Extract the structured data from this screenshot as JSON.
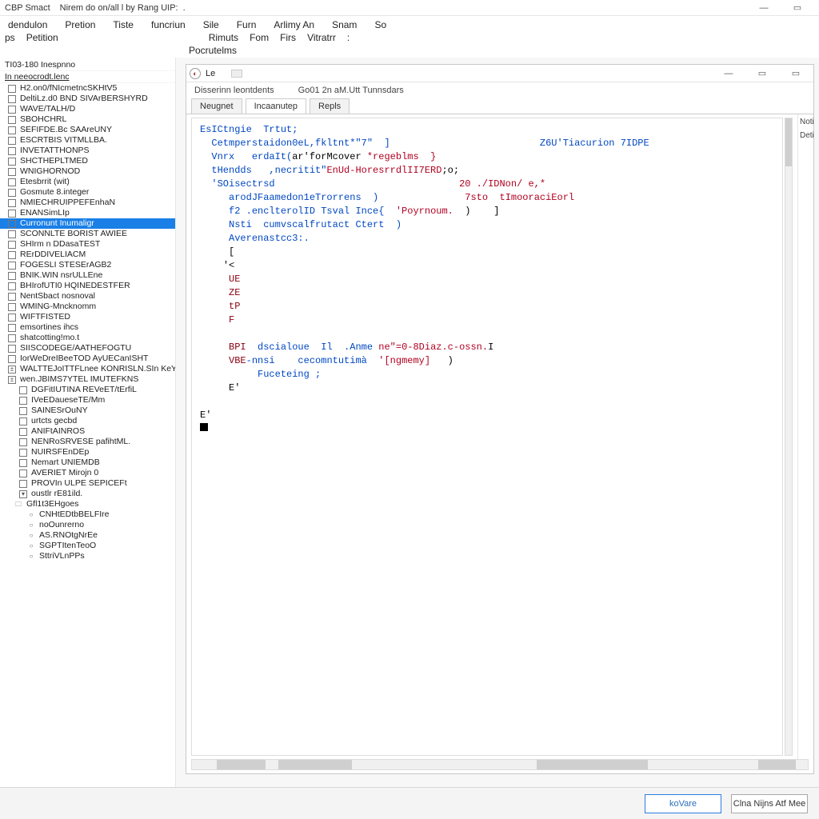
{
  "titlebar": {
    "app": "CBP Smact",
    "subtitle": "Nirem do on/all l by Rang UIP:",
    "path_sep": "."
  },
  "menubar": [
    "dendulon",
    "Pretion",
    "Tiste",
    "funcriun",
    "Sile",
    "Furn",
    "Arlimy An",
    "Snam",
    "So"
  ],
  "submenubar_left": [
    "ps",
    "Petition"
  ],
  "submenubar_right": [
    "Rimuts",
    "Fom",
    "Firs",
    "Vitratrr",
    ":"
  ],
  "subsubmenubar": [
    "Pocrutelms"
  ],
  "sidebar": {
    "root1": "TI03-180 Inespnno",
    "root2": "In neeocrodt.lenc",
    "items": [
      "H2.on0/fNIcmetncSKHtV5",
      "DeltiLz.d0 BND SIVArBERSHYRD",
      "WAVE/TALH/D",
      "SBOHCHRL",
      "SEFIFDE.Bc SAAreUNY",
      "ESCRTBIS VITMLLBA.",
      "INVETATTHONPS",
      "SHCTHEPLTMED",
      "WNIGHORNOD",
      "Etesbrrit (wit)",
      "Gosmute 8.integer",
      "NMIECHRUIPPEFEnhaN",
      "ENANSimLIp",
      "Curronunt Inumaligr",
      "SCONNLTE BORIST AWIEE",
      "SHIrm n DDasaTEST",
      "RErDDIVELIACM",
      "FOGESLI STESErAGB2",
      "BNIK.WIN nsrULLEne",
      "BHIrofUTI0 HQINEDESTFER",
      "NentSbact nosnoval",
      "WMING-Mncknomm",
      "WIFTFISTED",
      "emsortines ihcs",
      "shatcotting!mo.t",
      "SIISCODEGE/AATHEFOGTU",
      "IorWeDreIBeeTOD AyUECanISHT",
      "WALTTEJoITTFLnee KONRISLN.SIn KeY",
      "wen.JBIMS7YTEL IMUTEFKNS"
    ],
    "subitems": [
      "DGFitIUTINA REVeET/tErfiL",
      "IVeEDaueseTE/Mm",
      "SAINESrOuNY",
      "urtcts gecbd",
      "ANIFtAINROS",
      "NENRoSRVESE pafihtML.",
      "NUIRSFEnDEp",
      "Nemart UNIEMDB",
      "AVERIET Mirojn 0",
      "PROVIn ULPE SEPICEFt"
    ],
    "sub2header": "oustlr rE81ild.",
    "sub2items": [
      "Gfl1t3EHgoes",
      "CNHtEDtbBELFIre",
      "noOunrerno",
      "AS.RNOtgNrEe",
      "SGPTItenTeoO",
      "SttriVLnPPs"
    ]
  },
  "childwin": {
    "title": "Le",
    "tabrow_top": {
      "left": "Disserinn leontdents",
      "right": "Go01 2n aM.Utt Tunnsdars"
    },
    "tabs": [
      "Neugnet",
      "Incaanutep",
      "Repls"
    ],
    "active_tab": 1,
    "right_labels": [
      "Noti",
      "Deti"
    ]
  },
  "code": {
    "l1": "EsICtngie  Trtut;",
    "l2a": "Cetmperstaidon0eL,fkltnt*\"7\"  ]",
    "l2b": "Z6U'Tiacurion 7IDPE",
    "l3a": "Vnrx   erdaIt(",
    "l3b": "ar'forMcover ",
    "l3c": "*regeblms  }",
    "l4a": "tHendds   ,necritit\"",
    "l4b": "EnUd-HoresrrdlII7ERD",
    "l4c": ";o;",
    "l5a": "'SOisectrsd",
    "l5b": "20 ./IDNon/ e,*",
    "l6a": "arodJFaamedon1eTrorrens  )",
    "l6b": "7sto  tImooraciEorl",
    "l7a": "f2 .enclterolID Tsval Ince{  ",
    "l7b": "'Poyrnoum.",
    "l7c": "  )    ]",
    "l8a": "Nsti  cumvscalfrutact Ctert  )",
    "l9a": "Averenastcc3:.",
    "l10": "[",
    "l11": "'<",
    "l12": "UE",
    "l13": "ZE",
    "l14": "tP",
    "l15": "F",
    "l16a": "BPI",
    "l16b": "  dscialoue  Il  .Anme ",
    "l16c": "ne\"=0-8Diaz.c-ossn.",
    "l16d": "I",
    "l17a": "VBE",
    "l17b": "-nnsi    cecomntutimà  ",
    "l17c": "'[ngmemy]",
    "l17d": "   )",
    "l18": "Fuceteing ;",
    "l19": "E'",
    "l20": "E'"
  },
  "footer": {
    "primary": "koVare",
    "secondary": "Clna Nijns Atf Mee"
  }
}
